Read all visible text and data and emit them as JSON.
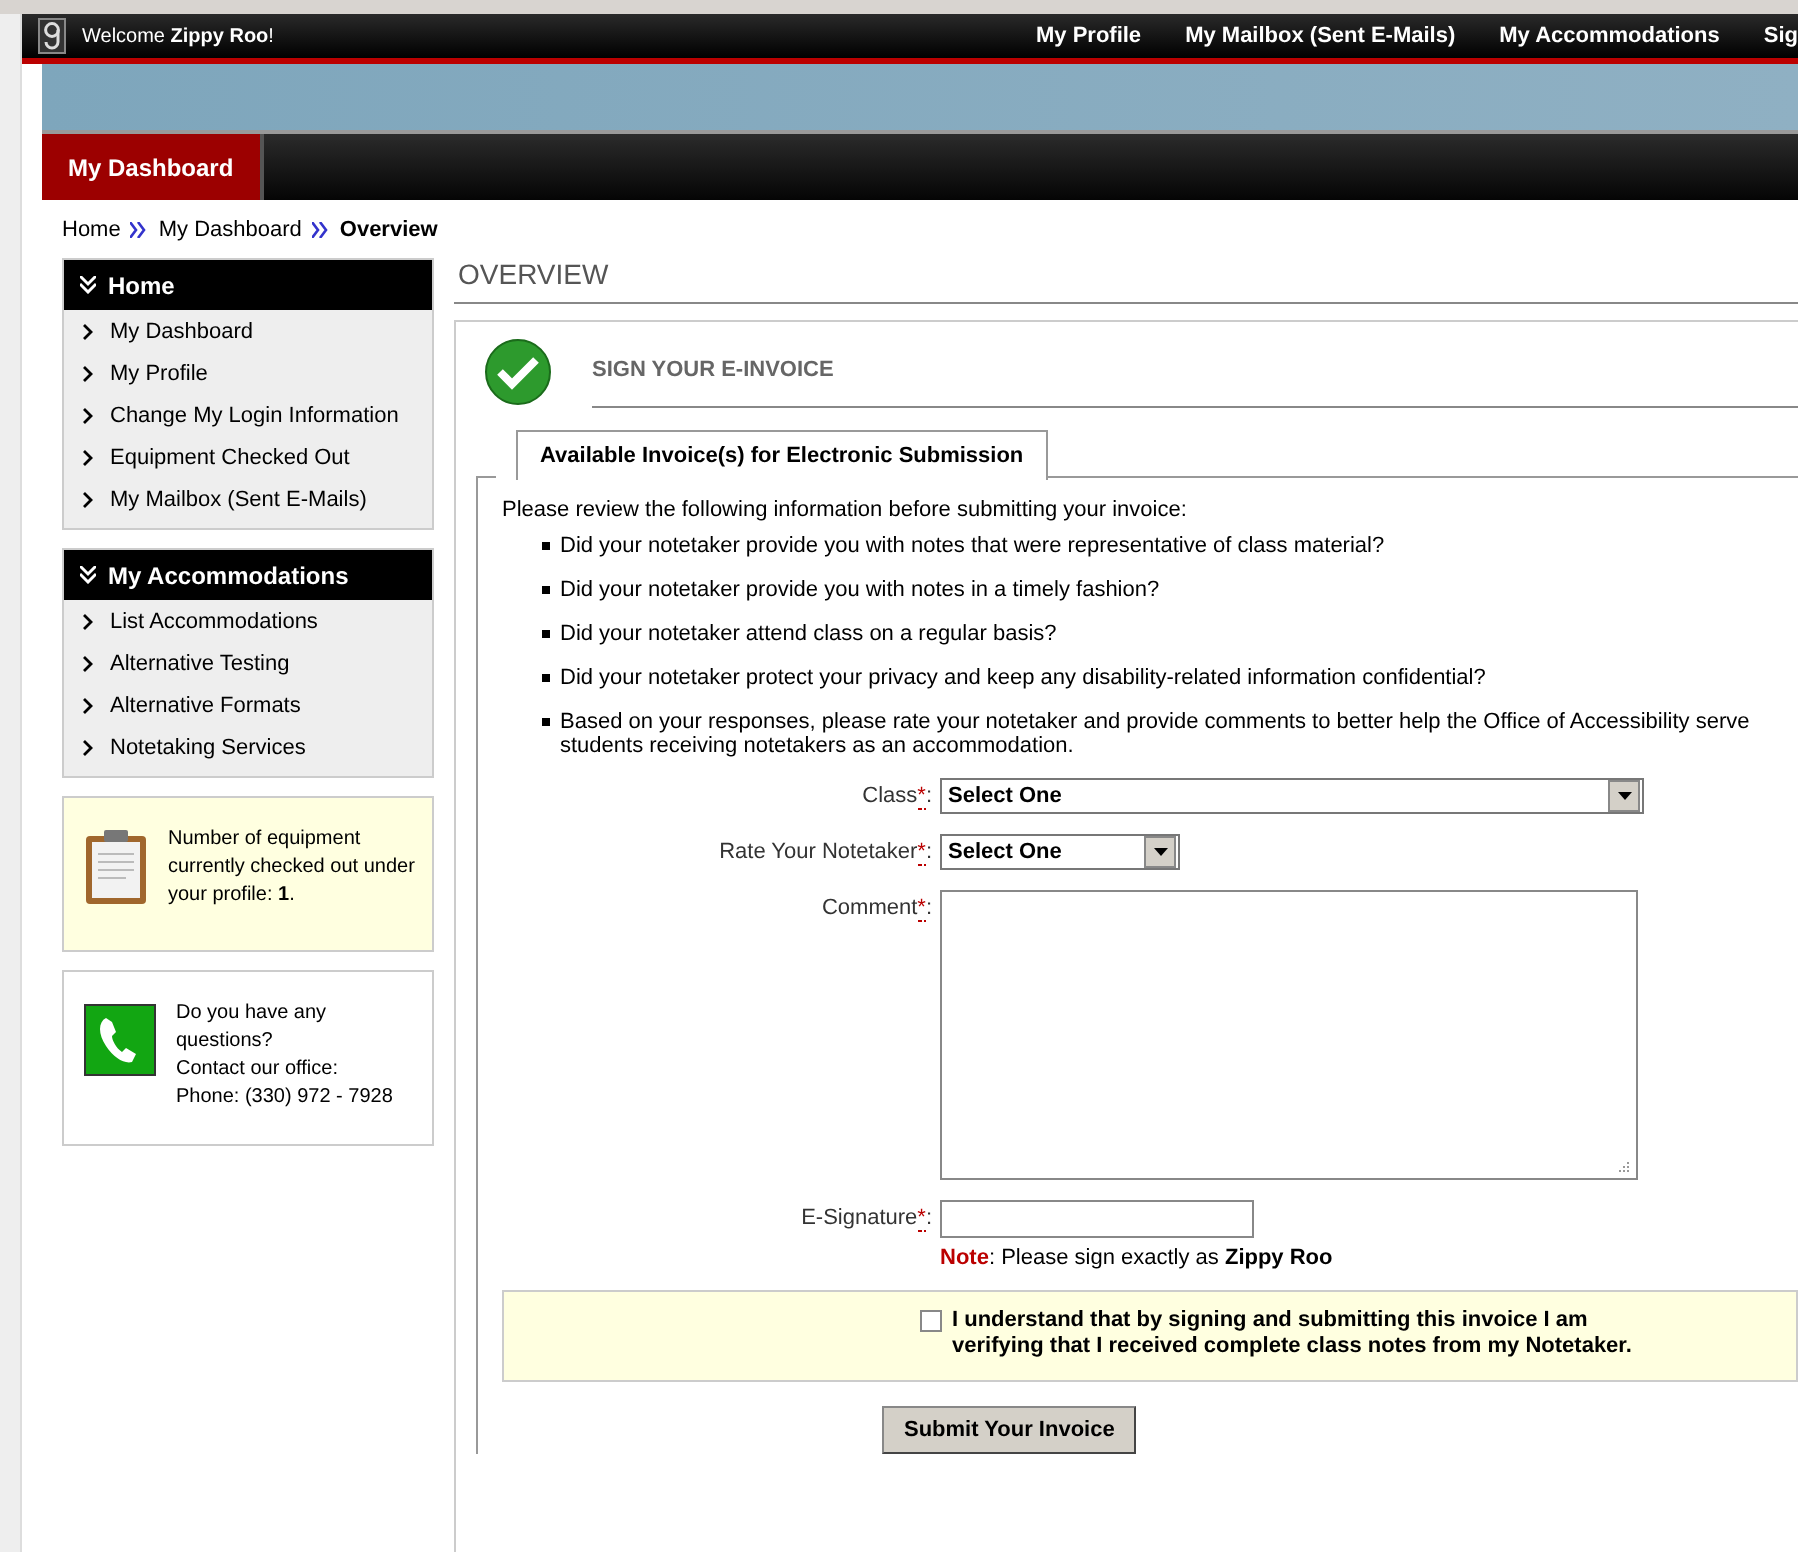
{
  "top_bar": {
    "welcome": "Welcome **Zippy Roo**!",
    "links": [
      "My Profile",
      "My Mailbox (Sent E-Mails)",
      "My Accommodations",
      "Sig"
    ]
  },
  "nav_tabs": [
    {
      "label": "My Dashboard",
      "selected": true
    }
  ],
  "breadcrumb": [
    {
      "label": "Home",
      "current": false
    },
    {
      "label": "My Dashboard",
      "current": false
    },
    {
      "label": "Overview",
      "current": true
    }
  ],
  "sidebar": [
    {
      "title": "Home",
      "items": [
        "My Dashboard",
        "My Profile",
        "Change My Login Information",
        "Equipment Checked Out",
        "My Mailbox (Sent E-Mails)"
      ]
    },
    {
      "title": "My Accommodations",
      "items": [
        "List Accommodations",
        "Alternative Testing",
        "Alternative Formats",
        "Notetaking Services"
      ]
    }
  ],
  "info_boxes": [
    {
      "kind": "equipment",
      "text": "Number of equipment currently checked out under your profile: **1**."
    },
    {
      "kind": "contact",
      "lines": [
        "Do you have any questions?",
        "Contact our office:",
        "Phone: (330) 972 - 7928"
      ]
    }
  ],
  "page_title": "OVERVIEW",
  "section_title": "SIGN YOUR E-INVOICE",
  "tab": "Available Invoice(s) for Electronic Submission",
  "intro": "Please review the following information before submitting your invoice:",
  "questions": [
    "Did your notetaker provide you with notes that were representative of class material?",
    "Did your notetaker provide you with notes in a timely fashion?",
    "Did your notetaker attend class on a regular basis?",
    "Did your notetaker protect your privacy and keep any disability-related information confidential?",
    "Based on your responses, please rate your notetaker and provide comments to better help the Office of Accessibility serve students receiving notetakers as an accommodation."
  ],
  "form": [
    {
      "kind": "select",
      "label": "Class",
      "mark": "*",
      "suffix": ":",
      "value": "Select One",
      "wide": true
    },
    {
      "kind": "select",
      "label": "Rate Your Notetaker",
      "mark": "*",
      "suffix": ":",
      "value": "Select One",
      "wide": false
    },
    {
      "kind": "textarea",
      "label": "Comment",
      "mark": "*",
      "suffix": ":"
    },
    {
      "kind": "text",
      "label": "E-Signature",
      "mark": "*",
      "suffix": ":",
      "note_label": "Note",
      "note": ": Please sign exactly as **Zippy Roo**"
    }
  ],
  "agreement": {
    "checked": false,
    "text": "I understand that by signing and submitting this invoice I am verifying that I received complete class notes from my Notetaker."
  },
  "submit": "Submit Your Invoice"
}
